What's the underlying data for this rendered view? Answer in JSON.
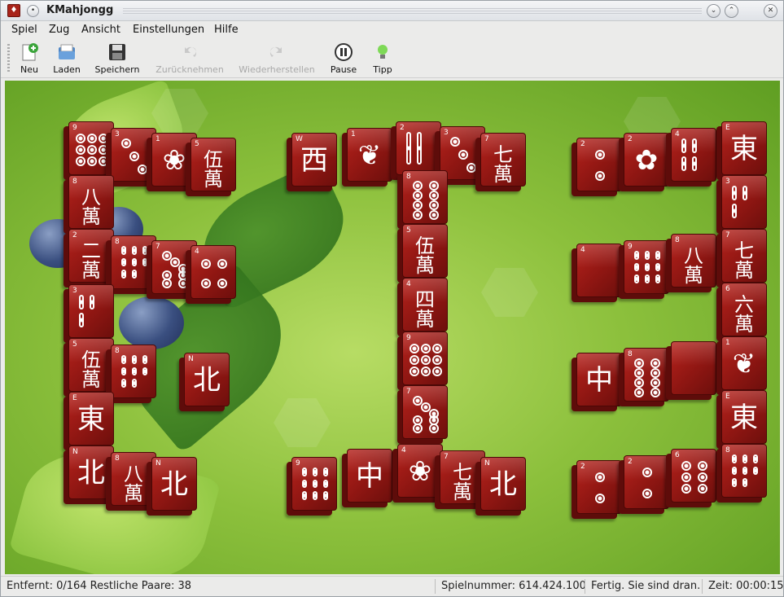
{
  "window": {
    "title": "KMahjongg"
  },
  "menubar": {
    "items": [
      "Spiel",
      "Zug",
      "Ansicht",
      "Einstellungen",
      "Hilfe"
    ]
  },
  "toolbar": {
    "new_label": "Neu",
    "load_label": "Laden",
    "save_label": "Speichern",
    "undo_label": "Zurücknehmen",
    "redo_label": "Wiederherstellen",
    "pause_label": "Pause",
    "hint_label": "Tipp"
  },
  "colors": {
    "tile_face": "#a51c17",
    "tile_side": "#5e0c0a",
    "board_green": "#8cc03c"
  },
  "status": {
    "removed": "Entfernt: 0/164 Restliche Paare: 38",
    "game_number": "Spielnummer: 614.424.100",
    "state": "Fertig. Sie sind dran.",
    "time": "Zeit: 00:00:15"
  },
  "tiles": [
    {
      "g": "dots9",
      "n": "9"
    },
    {
      "g": "dots3",
      "n": "3"
    },
    {
      "g": "flower",
      "n": "1"
    },
    {
      "g": "伍\n萬",
      "n": "5"
    },
    {
      "g": "八\n萬",
      "n": "8"
    },
    {
      "g": "二\n萬",
      "n": "2"
    },
    {
      "g": "bam8",
      "n": "8"
    },
    {
      "g": "dots7",
      "n": "7"
    },
    {
      "g": "dots4",
      "n": "4"
    },
    {
      "g": "bam3",
      "n": "3"
    },
    {
      "g": "伍\n萬",
      "n": "5"
    },
    {
      "g": "bam8",
      "n": "8"
    },
    {
      "g": "北",
      "n": "N"
    },
    {
      "g": "東",
      "n": "E"
    },
    {
      "g": "北",
      "n": "N"
    },
    {
      "g": "八\n萬",
      "n": "8"
    },
    {
      "g": "北",
      "n": "N"
    },
    {
      "g": "西",
      "n": "W"
    },
    {
      "g": "bird",
      "n": "1"
    },
    {
      "g": "bam2",
      "n": "2"
    },
    {
      "g": "dots3",
      "n": "3"
    },
    {
      "g": "七\n萬",
      "n": "7"
    },
    {
      "g": "dots8",
      "n": "8"
    },
    {
      "g": "伍\n萬",
      "n": "5"
    },
    {
      "g": "四\n萬",
      "n": "4"
    },
    {
      "g": "dots9",
      "n": "9"
    },
    {
      "g": "dots7",
      "n": "7"
    },
    {
      "g": "bam9",
      "n": "9"
    },
    {
      "g": "中",
      "n": ""
    },
    {
      "g": "flower",
      "n": "4"
    },
    {
      "g": "七\n萬",
      "n": "7"
    },
    {
      "g": "北",
      "n": "N"
    },
    {
      "g": "dots2",
      "n": "2"
    },
    {
      "g": "orchid",
      "n": "2"
    },
    {
      "g": "bam4",
      "n": "4"
    },
    {
      "g": "東",
      "n": "E"
    },
    {
      "g": "bam3",
      "n": "3"
    },
    {
      "g": "bamboo",
      "n": "4"
    },
    {
      "g": "bam9",
      "n": "9"
    },
    {
      "g": "八\n萬",
      "n": "8"
    },
    {
      "g": "七\n萬",
      "n": "7"
    },
    {
      "g": "六\n萬",
      "n": "6"
    },
    {
      "g": "中",
      "n": ""
    },
    {
      "g": "dots8",
      "n": "8"
    },
    {
      "g": "blank",
      "n": ""
    },
    {
      "g": "bird",
      "n": "1"
    },
    {
      "g": "東",
      "n": "E"
    },
    {
      "g": "dots2",
      "n": "2"
    },
    {
      "g": "dots2",
      "n": "2"
    },
    {
      "g": "dots6",
      "n": "6"
    },
    {
      "g": "bam8",
      "n": "8"
    }
  ]
}
